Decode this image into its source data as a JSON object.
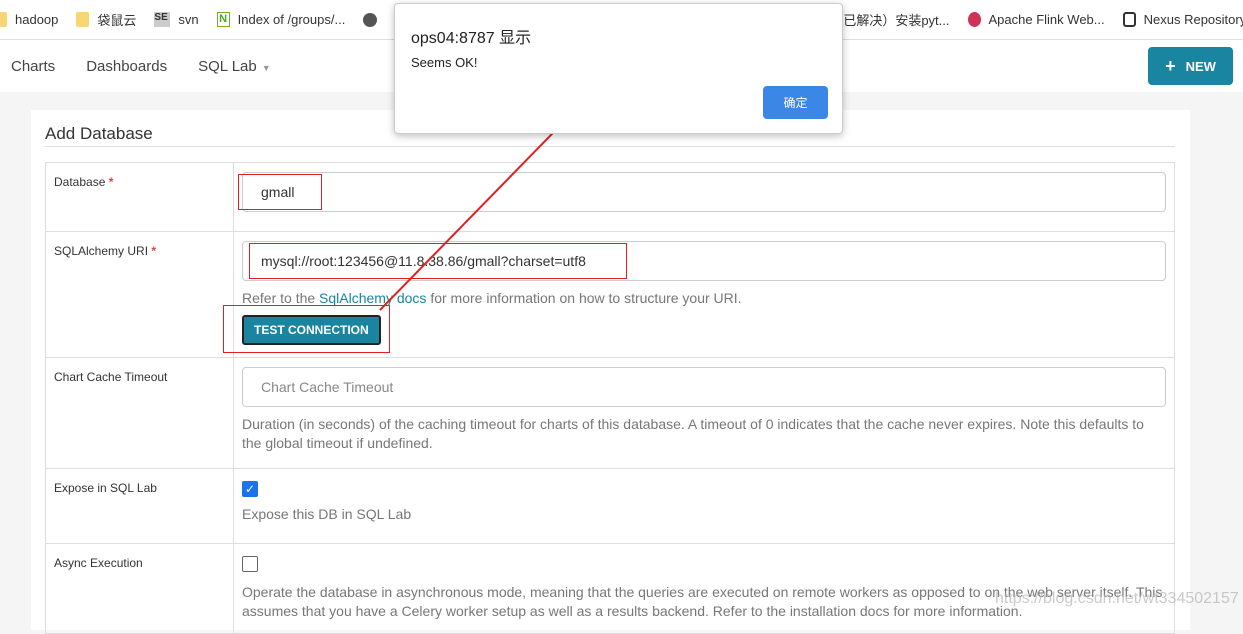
{
  "bookmarks": [
    {
      "label": "hadoop",
      "icon": "folder-icon"
    },
    {
      "label": "袋鼠云",
      "icon": "folder-icon"
    },
    {
      "label": "svn",
      "icon": "se-icon"
    },
    {
      "label": "Index of /groups/...",
      "icon": "n-icon"
    },
    {
      "label": "",
      "icon": "globe-icon"
    },
    {
      "label": "已解决）安装pyt...",
      "icon": ""
    },
    {
      "label": "Apache Flink Web...",
      "icon": "flink-icon"
    },
    {
      "label": "Nexus Repository",
      "icon": "nexus-icon"
    }
  ],
  "nav": {
    "items": [
      "Charts",
      "Dashboards",
      "SQL Lab"
    ],
    "new_button": "NEW"
  },
  "form": {
    "title": "Add Database",
    "database": {
      "label": "Database",
      "value": "gmall"
    },
    "uri": {
      "label": "SQLAlchemy URI",
      "value": "mysql://root:123456@11.8.38.86/gmall?charset=utf8",
      "help_pre": "Refer to the ",
      "help_link": "SqlAlchemy docs",
      "help_post": " for more information on how to structure your URI.",
      "test_button": "TEST CONNECTION"
    },
    "cache": {
      "label": "Chart Cache Timeout",
      "placeholder": "Chart Cache Timeout",
      "help": "Duration (in seconds) of the caching timeout for charts of this database. A timeout of 0 indicates that the cache never expires. Note this defaults to the global timeout if undefined."
    },
    "expose": {
      "label": "Expose in SQL Lab",
      "checked": true,
      "help": "Expose this DB in SQL Lab"
    },
    "async": {
      "label": "Async Execution",
      "checked": false,
      "help": "Operate the database in asynchronous mode, meaning that the queries are executed on remote workers as opposed to on the web server itself. This assumes that you have a Celery worker setup as well as a results backend. Refer to the installation docs for more information."
    }
  },
  "dialog": {
    "title": "ops04:8787 显示",
    "message": "Seems OK!",
    "ok": "确定"
  },
  "watermark": "https://blog.csdn.net/wt334502157",
  "colors": {
    "accent": "#1a85a0",
    "annotation": "#e02020"
  }
}
